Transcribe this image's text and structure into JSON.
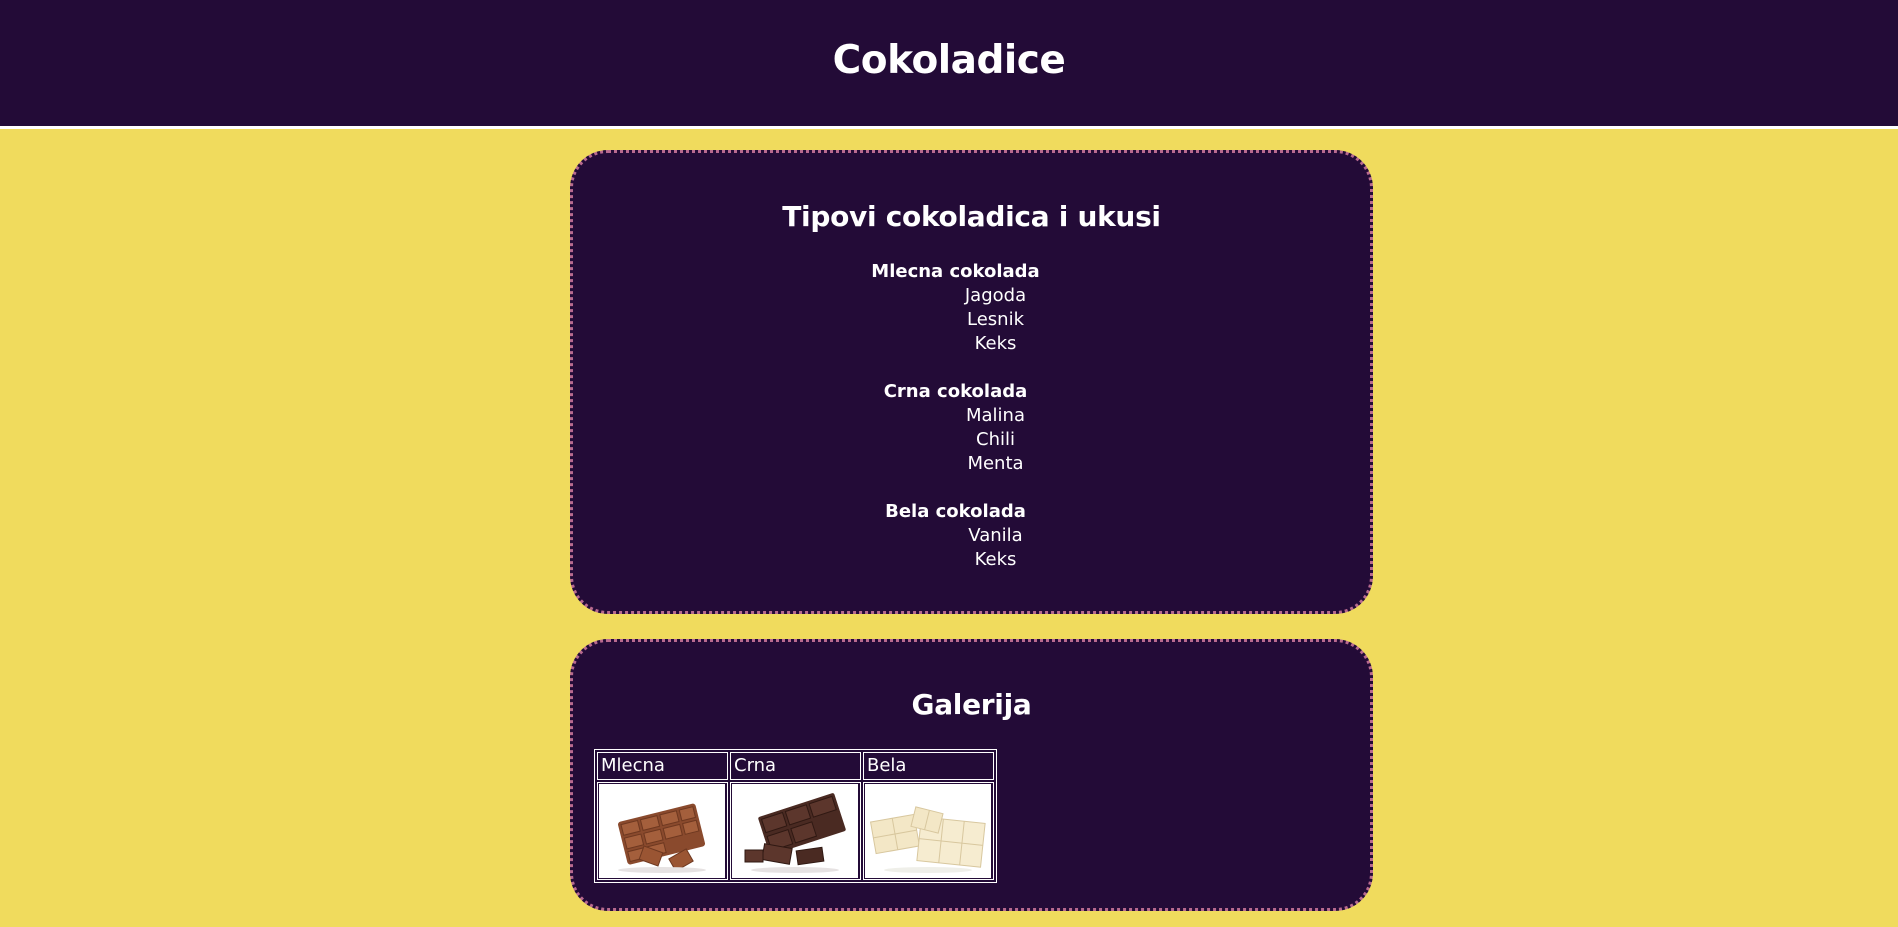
{
  "header": {
    "title": "Cokoladice"
  },
  "types_section": {
    "heading": "Tipovi cokoladica i ukusi",
    "groups": [
      {
        "name": "Mlecna cokolada",
        "flavors": [
          "Jagoda",
          "Lesnik",
          "Keks"
        ]
      },
      {
        "name": "Crna cokolada",
        "flavors": [
          "Malina",
          "Chili",
          "Menta"
        ]
      },
      {
        "name": "Bela cokolada",
        "flavors": [
          "Vanila",
          "Keks"
        ]
      }
    ]
  },
  "gallery_section": {
    "heading": "Galerija",
    "columns": [
      {
        "label": "Mlecna",
        "image": "milk-chocolate-image"
      },
      {
        "label": "Crna",
        "image": "dark-chocolate-image"
      },
      {
        "label": "Bela",
        "image": "white-chocolate-image"
      }
    ]
  },
  "colors": {
    "page_background": "#f0db5d",
    "panel_background": "#230b37",
    "panel_border": "#b86a8f",
    "text": "#ffffff"
  }
}
